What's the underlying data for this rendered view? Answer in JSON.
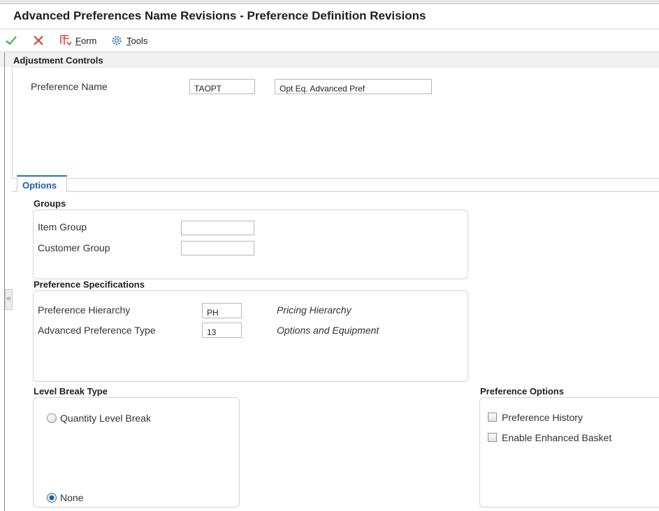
{
  "header": {
    "title": "Advanced Preferences Name Revisions - Preference Definition Revisions"
  },
  "toolbar": {
    "ok_icon": "checkmark-icon",
    "cancel_icon": "cancel-x-icon",
    "form_label": "Form",
    "form_icon": "form-menu-icon",
    "tools_label": "Tools",
    "tools_icon": "gear-icon"
  },
  "adjustment_controls": {
    "section_title": "Adjustment Controls",
    "preference_name_label": "Preference Name",
    "preference_name_value": "TAOPT",
    "preference_description_value": "Opt Eq. Advanced Pref"
  },
  "tabs": [
    {
      "label": "Options",
      "active": true
    }
  ],
  "groups": {
    "title": "Groups",
    "item_group_label": "Item Group",
    "item_group_value": "",
    "customer_group_label": "Customer Group",
    "customer_group_value": ""
  },
  "preference_specifications": {
    "title": "Preference Specifications",
    "hierarchy_label": "Preference Hierarchy",
    "hierarchy_value": "PH",
    "hierarchy_desc": "Pricing Hierarchy",
    "type_label": "Advanced Preference Type",
    "type_value": "13",
    "type_desc": "Options and Equipment"
  },
  "level_break_type": {
    "title": "Level Break Type",
    "options": [
      {
        "label": "Quantity Level Break",
        "selected": false
      },
      {
        "label": "None",
        "selected": true
      }
    ]
  },
  "preference_options": {
    "title": "Preference Options",
    "checkboxes": [
      {
        "label": "Preference History",
        "checked": false
      },
      {
        "label": "Enable Enhanced Basket",
        "checked": false
      }
    ]
  },
  "colors": {
    "ok_green": "#3aa34a",
    "cancel_red": "#d93a2b",
    "tab_blue": "#1d5fa6",
    "form_icon_red": "#d9453b",
    "tools_icon_blue": "#3b7cc0"
  },
  "collapse_handle_glyph": "«"
}
